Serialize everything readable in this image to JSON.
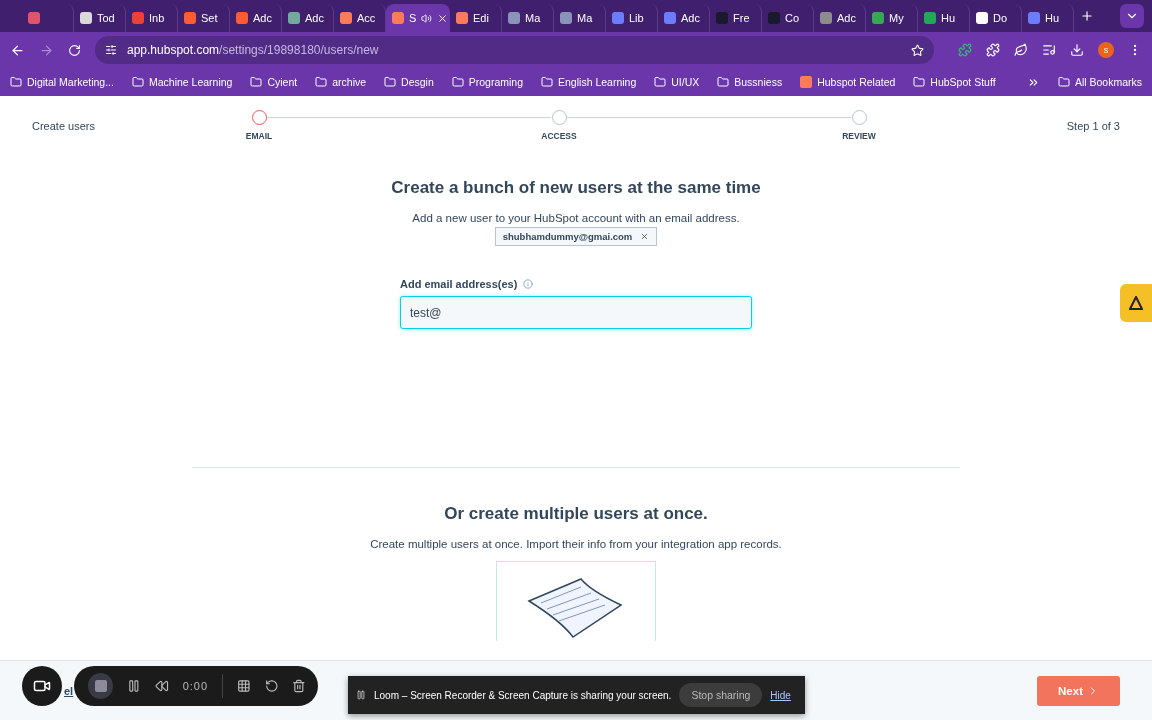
{
  "browser": {
    "tabs": [
      {
        "color": "#e2536b",
        "selected": false,
        "audio": false
      },
      {
        "label": "Tod",
        "color": "#d9d9d9",
        "selected": false,
        "audio": false
      },
      {
        "label": "Inb",
        "color": "#ea4335",
        "selected": false,
        "audio": false
      },
      {
        "label": "Set",
        "color": "#ff5c35",
        "selected": false,
        "audio": false
      },
      {
        "label": "Adc",
        "color": "#ff5c35",
        "selected": false,
        "audio": false
      },
      {
        "label": "Adc",
        "color": "#74aa9c",
        "selected": false,
        "audio": false
      },
      {
        "label": "Acc",
        "color": "#ff7a59",
        "selected": false,
        "audio": false
      },
      {
        "label": "S",
        "color": "#ff7a59",
        "selected": true,
        "audio": true
      },
      {
        "label": "Edi",
        "color": "#ff7a59",
        "selected": false,
        "audio": false
      },
      {
        "label": "Ma",
        "color": "#8a93b8",
        "selected": false,
        "audio": false
      },
      {
        "label": "Ma",
        "color": "#8a93b8",
        "selected": false,
        "audio": false
      },
      {
        "label": "Lib",
        "color": "#6b7cff",
        "selected": false,
        "audio": false
      },
      {
        "label": "Adc",
        "color": "#6b7cff",
        "selected": false,
        "audio": false
      },
      {
        "label": "Fre",
        "color": "#1a1a2e",
        "selected": false,
        "audio": false
      },
      {
        "label": "Co",
        "color": "#1a1a2e",
        "selected": false,
        "audio": false
      },
      {
        "label": "Adc",
        "color": "#8c8c8c",
        "selected": false,
        "audio": false
      },
      {
        "label": "My",
        "color": "#34a853",
        "selected": false,
        "audio": false
      },
      {
        "label": "Hu",
        "color": "#1faa55",
        "selected": false,
        "audio": false
      },
      {
        "label": "Do",
        "color": "#ffffff",
        "selected": false,
        "audio": false
      },
      {
        "label": "Hu",
        "color": "#6b7cff",
        "selected": false,
        "audio": false
      }
    ],
    "address": {
      "host": "app.hubspot.com",
      "path": "/settings/19898180/users/new"
    },
    "avatar": "s",
    "bookmarks": [
      {
        "label": "Digital Marketing...",
        "kind": "folder"
      },
      {
        "label": "Machine Learning",
        "kind": "folder"
      },
      {
        "label": "Cyient",
        "kind": "folder"
      },
      {
        "label": "archive",
        "kind": "folder"
      },
      {
        "label": "Desgin",
        "kind": "folder"
      },
      {
        "label": "Programing",
        "kind": "folder"
      },
      {
        "label": "English Learning",
        "kind": "folder"
      },
      {
        "label": "UI/UX",
        "kind": "folder"
      },
      {
        "label": "Bussniess",
        "kind": "folder"
      },
      {
        "label": "Hubspot Related",
        "kind": "site"
      },
      {
        "label": "HubSpot Stuff",
        "kind": "folder"
      }
    ],
    "all_bookmarks": "All Bookmarks"
  },
  "header": {
    "title": "Create users",
    "steps": [
      {
        "label": "EMAIL",
        "selected": true
      },
      {
        "label": "ACCESS",
        "selected": false
      },
      {
        "label": "REVIEW",
        "selected": false
      }
    ],
    "counter": "Step 1 of 3"
  },
  "single": {
    "heading": "Create a bunch of new users at the same time",
    "subtitle": "Add a new user to your HubSpot account with an email address.",
    "chips": [
      {
        "label": "shubhamdummy@gmai.com"
      }
    ],
    "field": {
      "label": "Add email address(es)",
      "value": "test@"
    }
  },
  "multiple": {
    "heading": "Or create multiple users at once.",
    "subtitle": "Create multiple users at once. Import their info from your integration app records."
  },
  "footer": {
    "cancel": "el",
    "next": "Next"
  },
  "recorder": {
    "time": "0:00"
  },
  "share_bar": {
    "message": "Loom – Screen Recorder & Screen Capture is sharing your screen.",
    "stop": "Stop sharing",
    "hide": "Hide"
  }
}
